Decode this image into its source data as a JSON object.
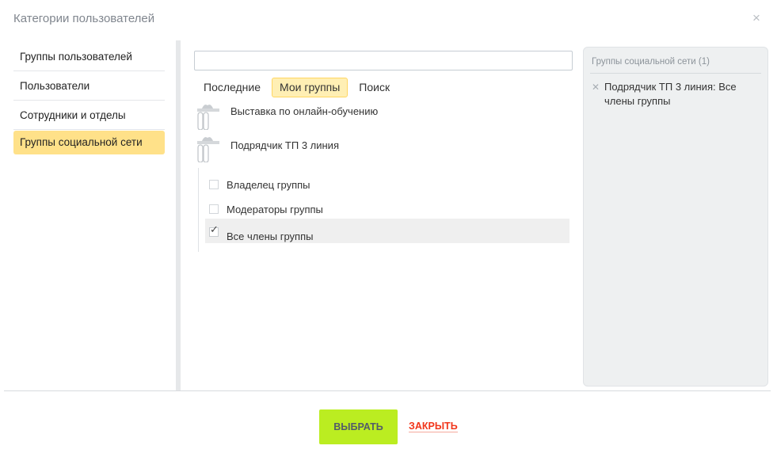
{
  "dialog": {
    "title": "Категории пользователей",
    "close_glyph": "×"
  },
  "nav": {
    "items": [
      {
        "label": "Группы пользователей",
        "active": false
      },
      {
        "label": "Пользователи",
        "active": false
      },
      {
        "label": "Сотрудники и отделы",
        "active": false
      },
      {
        "label": "Группы социальной сети",
        "active": true
      }
    ]
  },
  "search": {
    "value": "",
    "placeholder": ""
  },
  "tabs": [
    {
      "label": "Последние",
      "active": false
    },
    {
      "label": "Мои группы",
      "active": true
    },
    {
      "label": "Поиск",
      "active": false
    }
  ],
  "groups": [
    {
      "name": "Выставка по онлайн-обучению",
      "icon": "group-icon"
    },
    {
      "name": "Подрядчик ТП 3 линия",
      "icon": "group-icon"
    }
  ],
  "roles": [
    {
      "label": "Владелец группы",
      "checked": false
    },
    {
      "label": "Модераторы группы",
      "checked": false
    },
    {
      "label": "Все члены группы",
      "checked": true
    }
  ],
  "selection": {
    "title": "Группы социальной сети (1)",
    "items": [
      {
        "label": "Подрядчик ТП 3 линия: Все члены группы"
      }
    ]
  },
  "footer": {
    "select_label": "ВЫБРАТЬ",
    "close_label": "ЗАКРЫТЬ"
  },
  "colors": {
    "active_nav": "#ffe189",
    "active_tab": "#ffefb4",
    "select_button": "#bbed21",
    "close_link": "#f1361b"
  }
}
